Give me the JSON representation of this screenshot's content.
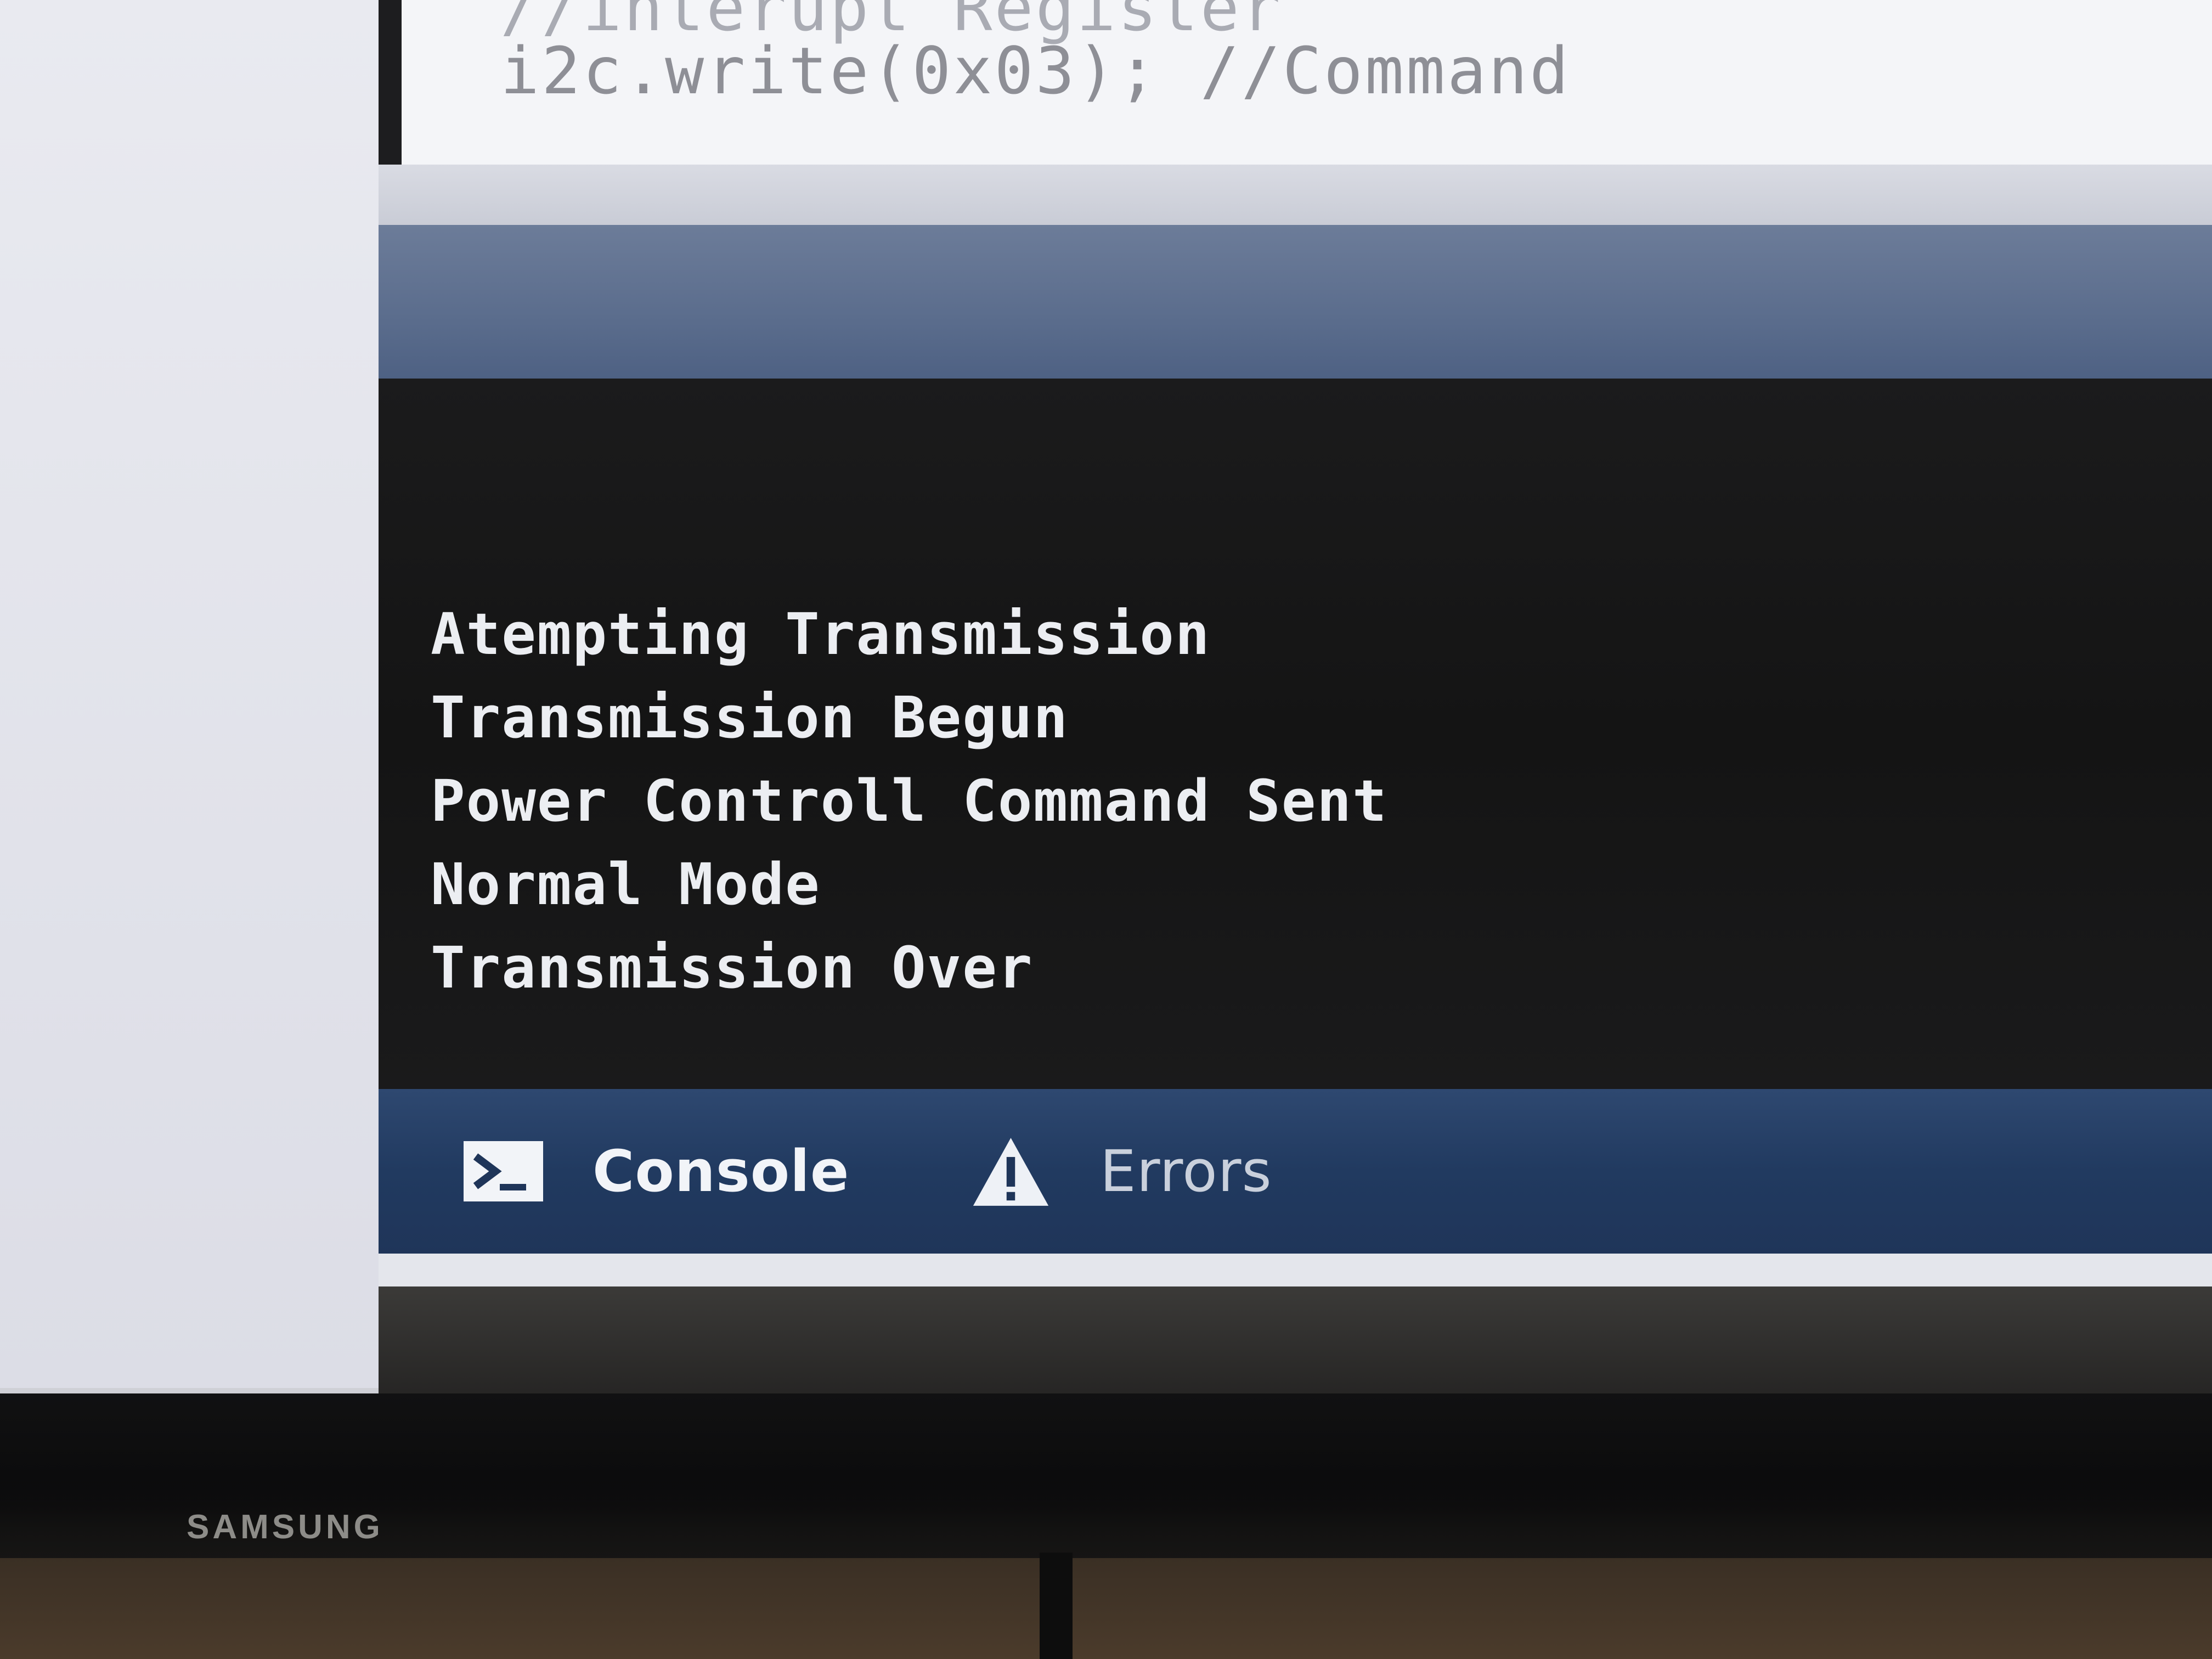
{
  "editor": {
    "code_lines": [
      "//interupt Register",
      "i2c.write(0x03); //Command"
    ]
  },
  "console": {
    "output_lines": [
      "Atempting Transmission",
      "Transmission Begun",
      "Power Controll Command Sent",
      "Normal Mode",
      "Transmission Over"
    ]
  },
  "tabs": {
    "console_label": "Console",
    "console_icon": "terminal-prompt-icon",
    "errors_label": "Errors",
    "errors_icon": "warning-triangle-icon"
  },
  "monitor": {
    "brand": "SAMSUNG"
  },
  "colors": {
    "console_background": "#161617",
    "tab_bar_blue": "#223b62",
    "console_text": "#eceef2"
  }
}
